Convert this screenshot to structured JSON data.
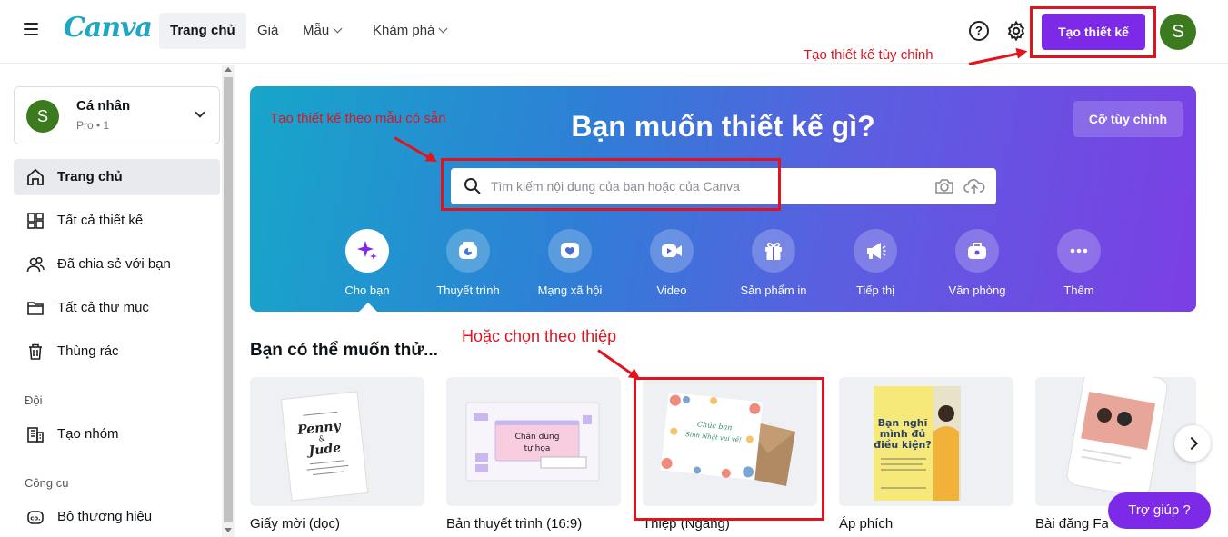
{
  "brand": {
    "logo_text": "Canva",
    "accent": "#7d2ae8",
    "logo_color": "#1ea7c5"
  },
  "topnav": {
    "items": [
      {
        "label": "Trang chủ",
        "active": true
      },
      {
        "label": "Giá"
      },
      {
        "label": "Mẫu",
        "dropdown": true
      },
      {
        "label": "Khám phá",
        "dropdown": true
      }
    ],
    "help_icon": "?",
    "create_button": "Tạo thiết kế",
    "avatar_initial": "S"
  },
  "annotations": {
    "custom_design": "Tạo thiết kế tùy chỉnh",
    "from_template": "Tạo thiết kế theo mẫu có sẵn",
    "choose_card": "Hoặc chọn theo thiệp",
    "color": "#e0141e"
  },
  "sidebar": {
    "account": {
      "initial": "S",
      "name": "Cá nhân",
      "plan": "Pro • 1"
    },
    "items": [
      {
        "label": "Trang chủ",
        "icon": "home-icon",
        "active": true
      },
      {
        "label": "Tất cả thiết kế",
        "icon": "grid-icon"
      },
      {
        "label": "Đã chia sẻ với bạn",
        "icon": "people-icon"
      },
      {
        "label": "Tất cả thư mục",
        "icon": "folder-icon"
      },
      {
        "label": "Thùng rác",
        "icon": "trash-icon"
      }
    ],
    "team_heading": "Đội",
    "team_item": {
      "label": "Tạo nhóm",
      "icon": "building-icon"
    },
    "tools_heading": "Công cụ",
    "tools_item": {
      "label": "Bộ thương hiệu",
      "icon": "brand-kit-icon"
    }
  },
  "hero": {
    "title": "Bạn muốn thiết kế gì?",
    "custom_size_button": "Cỡ tùy chỉnh",
    "search_placeholder": "Tìm kiếm nội dung của bạn hoặc của Canva",
    "categories": [
      {
        "label": "Cho bạn",
        "icon": "sparkle-icon",
        "selected": true
      },
      {
        "label": "Thuyết trình",
        "icon": "presentation-icon"
      },
      {
        "label": "Mạng xã hội",
        "icon": "heart-icon"
      },
      {
        "label": "Video",
        "icon": "video-icon"
      },
      {
        "label": "Sản phẩm in",
        "icon": "gift-icon"
      },
      {
        "label": "Tiếp thị",
        "icon": "megaphone-icon"
      },
      {
        "label": "Văn phòng",
        "icon": "briefcase-icon"
      },
      {
        "label": "Thêm",
        "icon": "more-icon"
      }
    ]
  },
  "suggestions": {
    "title": "Bạn có thể muốn thử...",
    "cards": [
      {
        "label": "Giấy mời (dọc)",
        "thumb_text": [
          "Penny",
          "&",
          "Jude"
        ]
      },
      {
        "label": "Bản thuyết trình (16:9)",
        "thumb_text": [
          "Chân dung",
          "tự họa"
        ]
      },
      {
        "label": "Thiệp (Ngang)",
        "thumb_text": [
          "Chúc bạn",
          "Sinh Nhật vui vẻ!"
        ]
      },
      {
        "label": "Áp phích",
        "thumb_text": [
          "Bạn nghĩ",
          "mình đủ",
          "điều kiện?"
        ]
      },
      {
        "label": "Bài đăng Face"
      }
    ]
  },
  "help_button": "Trợ giúp  ?"
}
